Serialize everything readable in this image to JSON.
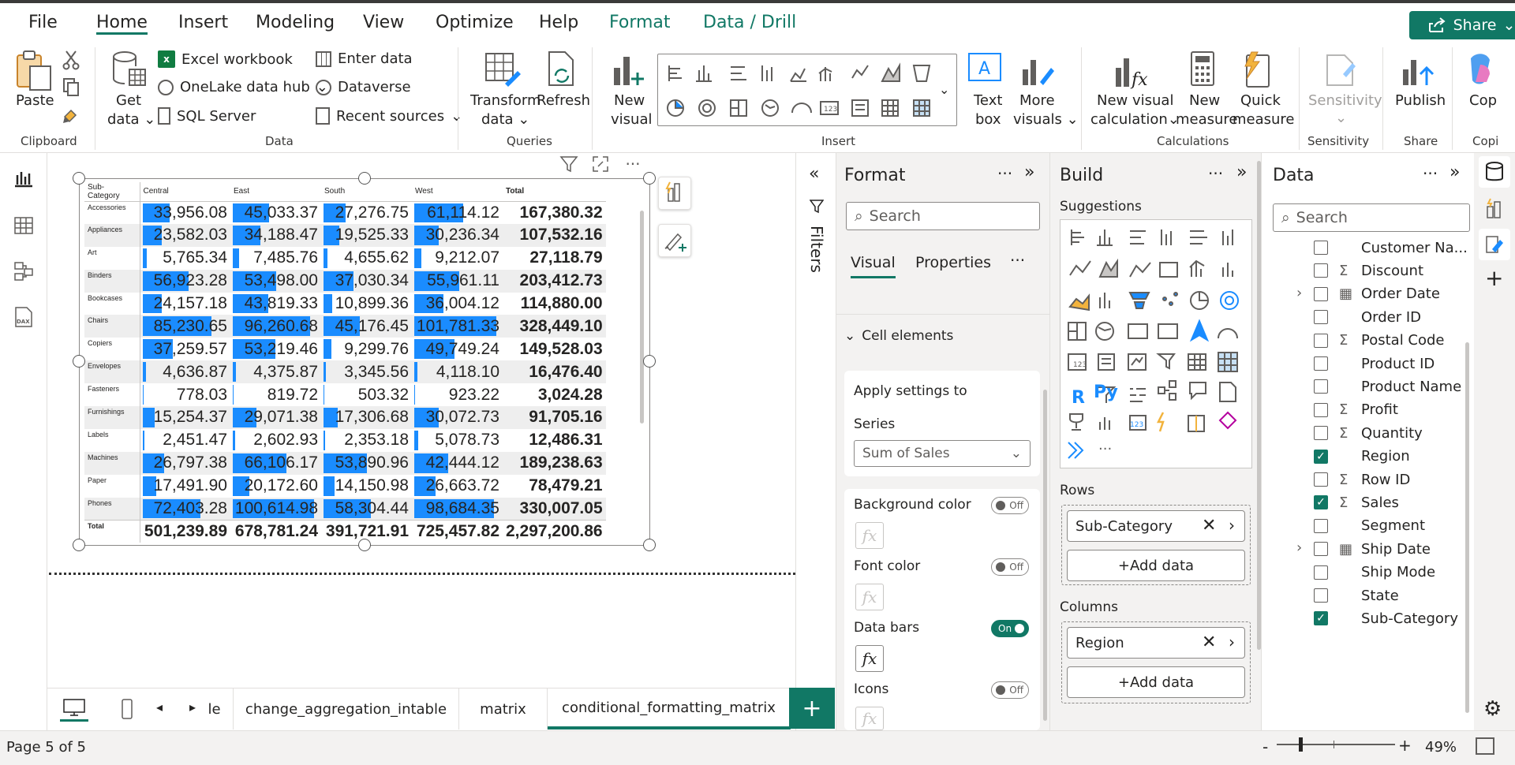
{
  "menu": {
    "file": "File",
    "home": "Home",
    "insert": "Insert",
    "modeling": "Modeling",
    "view": "View",
    "optimize": "Optimize",
    "help": "Help",
    "format": "Format",
    "data_drill": "Data / Drill",
    "share": "Share"
  },
  "ribbon": {
    "paste": "Paste",
    "clipboard": "Clipboard",
    "get": "Get",
    "data": "data",
    "excel": "Excel workbook",
    "onelake": "OneLake data hub",
    "sql": "SQL Server",
    "enter": "Enter data",
    "dataverse": "Dataverse",
    "recent": "Recent sources",
    "data_group": "Data",
    "transform": "Transform",
    "transform2": "data",
    "refresh": "Refresh",
    "queries": "Queries",
    "new_visual": "New",
    "new_visual2": "visual",
    "textbox": "Text",
    "textbox2": "box",
    "more": "More",
    "more2": "visuals",
    "insert_group": "Insert",
    "newcalc": "New visual",
    "newcalc2": "calculation",
    "newmeasure": "New",
    "newmeasure2": "measure",
    "quick": "Quick",
    "quick2": "measure",
    "calculations": "Calculations",
    "sensitivity": "Sensitivity",
    "sensitivity_group": "Sensitivity",
    "publish": "Publish",
    "share_group": "Share",
    "copilot": "Cop",
    "copilot_group": "Copi"
  },
  "matrix": {
    "headers": [
      "Sub-Category",
      "Central",
      "East",
      "South",
      "West",
      "Total"
    ],
    "rows": [
      {
        "cat": "Accessories",
        "v": [
          "33,956.08",
          "45,033.37",
          "27,276.75",
          "61,114.12"
        ],
        "t": "167,380.32",
        "n": [
          33956.08,
          45033.37,
          27276.75,
          61114.12
        ]
      },
      {
        "cat": "Appliances",
        "v": [
          "23,582.03",
          "34,188.47",
          "19,525.33",
          "30,236.34"
        ],
        "t": "107,532.16",
        "n": [
          23582.03,
          34188.47,
          19525.33,
          30236.34
        ]
      },
      {
        "cat": "Art",
        "v": [
          "5,765.34",
          "7,485.76",
          "4,655.62",
          "9,212.07"
        ],
        "t": "27,118.79",
        "n": [
          5765.34,
          7485.76,
          4655.62,
          9212.07
        ]
      },
      {
        "cat": "Binders",
        "v": [
          "56,923.28",
          "53,498.00",
          "37,030.34",
          "55,961.11"
        ],
        "t": "203,412.73",
        "n": [
          56923.28,
          53498.0,
          37030.34,
          55961.11
        ]
      },
      {
        "cat": "Bookcases",
        "v": [
          "24,157.18",
          "43,819.33",
          "10,899.36",
          "36,004.12"
        ],
        "t": "114,880.00",
        "n": [
          24157.18,
          43819.33,
          10899.36,
          36004.12
        ]
      },
      {
        "cat": "Chairs",
        "v": [
          "85,230.65",
          "96,260.68",
          "45,176.45",
          "101,781.33"
        ],
        "t": "328,449.10",
        "n": [
          85230.65,
          96260.68,
          45176.45,
          101781.33
        ]
      },
      {
        "cat": "Copiers",
        "v": [
          "37,259.57",
          "53,219.46",
          "9,299.76",
          "49,749.24"
        ],
        "t": "149,528.03",
        "n": [
          37259.57,
          53219.46,
          9299.76,
          49749.24
        ]
      },
      {
        "cat": "Envelopes",
        "v": [
          "4,636.87",
          "4,375.87",
          "3,345.56",
          "4,118.10"
        ],
        "t": "16,476.40",
        "n": [
          4636.87,
          4375.87,
          3345.56,
          4118.1
        ]
      },
      {
        "cat": "Fasteners",
        "v": [
          "778.03",
          "819.72",
          "503.32",
          "923.22"
        ],
        "t": "3,024.28",
        "n": [
          778.03,
          819.72,
          503.32,
          923.22
        ]
      },
      {
        "cat": "Furnishings",
        "v": [
          "15,254.37",
          "29,071.38",
          "17,306.68",
          "30,072.73"
        ],
        "t": "91,705.16",
        "n": [
          15254.37,
          29071.38,
          17306.68,
          30072.73
        ]
      },
      {
        "cat": "Labels",
        "v": [
          "2,451.47",
          "2,602.93",
          "2,353.18",
          "5,078.73"
        ],
        "t": "12,486.31",
        "n": [
          2451.47,
          2602.93,
          2353.18,
          5078.73
        ]
      },
      {
        "cat": "Machines",
        "v": [
          "26,797.38",
          "66,106.17",
          "53,890.96",
          "42,444.12"
        ],
        "t": "189,238.63",
        "n": [
          26797.38,
          66106.17,
          53890.96,
          42444.12
        ]
      },
      {
        "cat": "Paper",
        "v": [
          "17,491.90",
          "20,172.60",
          "14,150.98",
          "26,663.72"
        ],
        "t": "78,479.21",
        "n": [
          17491.9,
          20172.6,
          14150.98,
          26663.72
        ]
      },
      {
        "cat": "Phones",
        "v": [
          "72,403.28",
          "100,614.98",
          "58,304.44",
          "98,684.35"
        ],
        "t": "330,007.05",
        "n": [
          72403.28,
          100614.98,
          58304.44,
          98684.35
        ]
      }
    ],
    "total": {
      "cat": "Total",
      "v": [
        "501,239.89",
        "678,781.24",
        "391,721.91",
        "725,457.82"
      ],
      "t": "2,297,200.86"
    },
    "bar_color": "#1a8cff",
    "bar_max": 101781.33
  },
  "filters": {
    "label": "Filters"
  },
  "format": {
    "title": "Format",
    "search": "Search",
    "tab_visual": "Visual",
    "tab_properties": "Properties",
    "section": "Cell elements",
    "apply_to": "Apply settings to",
    "series_label": "Series",
    "series_value": "Sum of Sales",
    "bg_color": "Background color",
    "font_color": "Font color",
    "data_bars": "Data bars",
    "icons": "Icons",
    "off": "Off",
    "on": "On",
    "fx": "fx"
  },
  "build": {
    "title": "Build",
    "suggestions": "Suggestions",
    "rows": "Rows",
    "rows_field": "Sub-Category",
    "columns": "Columns",
    "columns_field": "Region",
    "add_data": "+Add data",
    "more": "..."
  },
  "datapane": {
    "title": "Data",
    "search": "Search",
    "fields": [
      {
        "name": "Customer Na...",
        "sigma": false,
        "checked": false,
        "expand": false,
        "cal": false
      },
      {
        "name": "Discount",
        "sigma": true,
        "checked": false,
        "expand": false,
        "cal": false
      },
      {
        "name": "Order Date",
        "sigma": false,
        "checked": false,
        "expand": true,
        "cal": true
      },
      {
        "name": "Order ID",
        "sigma": false,
        "checked": false,
        "expand": false,
        "cal": false
      },
      {
        "name": "Postal Code",
        "sigma": true,
        "checked": false,
        "expand": false,
        "cal": false
      },
      {
        "name": "Product ID",
        "sigma": false,
        "checked": false,
        "expand": false,
        "cal": false
      },
      {
        "name": "Product Name",
        "sigma": false,
        "checked": false,
        "expand": false,
        "cal": false
      },
      {
        "name": "Profit",
        "sigma": true,
        "checked": false,
        "expand": false,
        "cal": false
      },
      {
        "name": "Quantity",
        "sigma": true,
        "checked": false,
        "expand": false,
        "cal": false
      },
      {
        "name": "Region",
        "sigma": false,
        "checked": true,
        "expand": false,
        "cal": false
      },
      {
        "name": "Row ID",
        "sigma": true,
        "checked": false,
        "expand": false,
        "cal": false
      },
      {
        "name": "Sales",
        "sigma": true,
        "checked": true,
        "expand": false,
        "cal": false
      },
      {
        "name": "Segment",
        "sigma": false,
        "checked": false,
        "expand": false,
        "cal": false
      },
      {
        "name": "Ship Date",
        "sigma": false,
        "checked": false,
        "expand": true,
        "cal": true
      },
      {
        "name": "Ship Mode",
        "sigma": false,
        "checked": false,
        "expand": false,
        "cal": false
      },
      {
        "name": "State",
        "sigma": false,
        "checked": false,
        "expand": false,
        "cal": false
      },
      {
        "name": "Sub-Category",
        "sigma": false,
        "checked": true,
        "expand": false,
        "cal": false
      }
    ]
  },
  "tabs": {
    "t0": "le",
    "t1": "change_aggregation_intable",
    "t2": "matrix",
    "t3": "conditional_formatting_matrix",
    "add": "+"
  },
  "status": {
    "page": "Page 5 of 5",
    "zoom": "49%"
  },
  "colors": {
    "accent": "#117865",
    "bar": "#1a8cff"
  }
}
